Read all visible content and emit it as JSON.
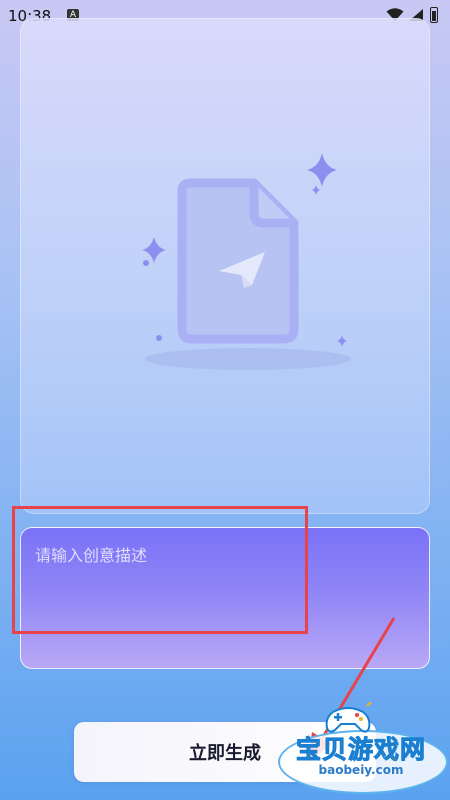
{
  "status_bar": {
    "time": "10:38",
    "notification_glyph": "A",
    "icons": [
      "wifi-icon",
      "signal-icon",
      "battery-icon"
    ]
  },
  "preview": {
    "illustration": "document-paper-plane-icon"
  },
  "prompt": {
    "placeholder": "请输入创意描述",
    "value": ""
  },
  "actions": {
    "generate_label": "立即生成"
  },
  "overlay": {
    "watermark_text": "宝贝游戏网",
    "watermark_url": "baobeiy.com",
    "highlight_color": "#e8434b"
  },
  "colors": {
    "accent_purple": "#7a72f7",
    "button_text": "#1b1b30"
  }
}
